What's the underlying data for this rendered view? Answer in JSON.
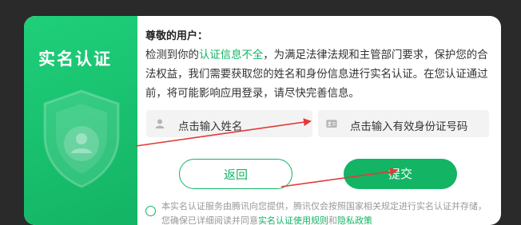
{
  "dialog": {
    "panel_title": "实名认证",
    "greeting": "尊敬的用户：",
    "message_prefix": "检测到你的",
    "message_highlight": "认证信息不全",
    "message_suffix": "，为满足法律法规和主管部门要求，保护您的合法权益，我们需要获取您的姓名和身份信息进行实名认证。在您认证通过前，将可能影响应用登录，请尽快完善信息。",
    "name_placeholder": "点击输入姓名",
    "id_placeholder": "点击输入有效身份证号码",
    "back_label": "返回",
    "submit_label": "提交",
    "agree_prefix": "本实名认证服务由腾讯向您提供，腾讯仅会按照国家相关规定进行实名认证并存储，您确保已详细阅读并同意",
    "agree_link1": "实名认证使用规则",
    "agree_mid": "和",
    "agree_link2": "隐私政策"
  },
  "colors": {
    "accent": "#13b464",
    "annotation": "#e53935"
  }
}
